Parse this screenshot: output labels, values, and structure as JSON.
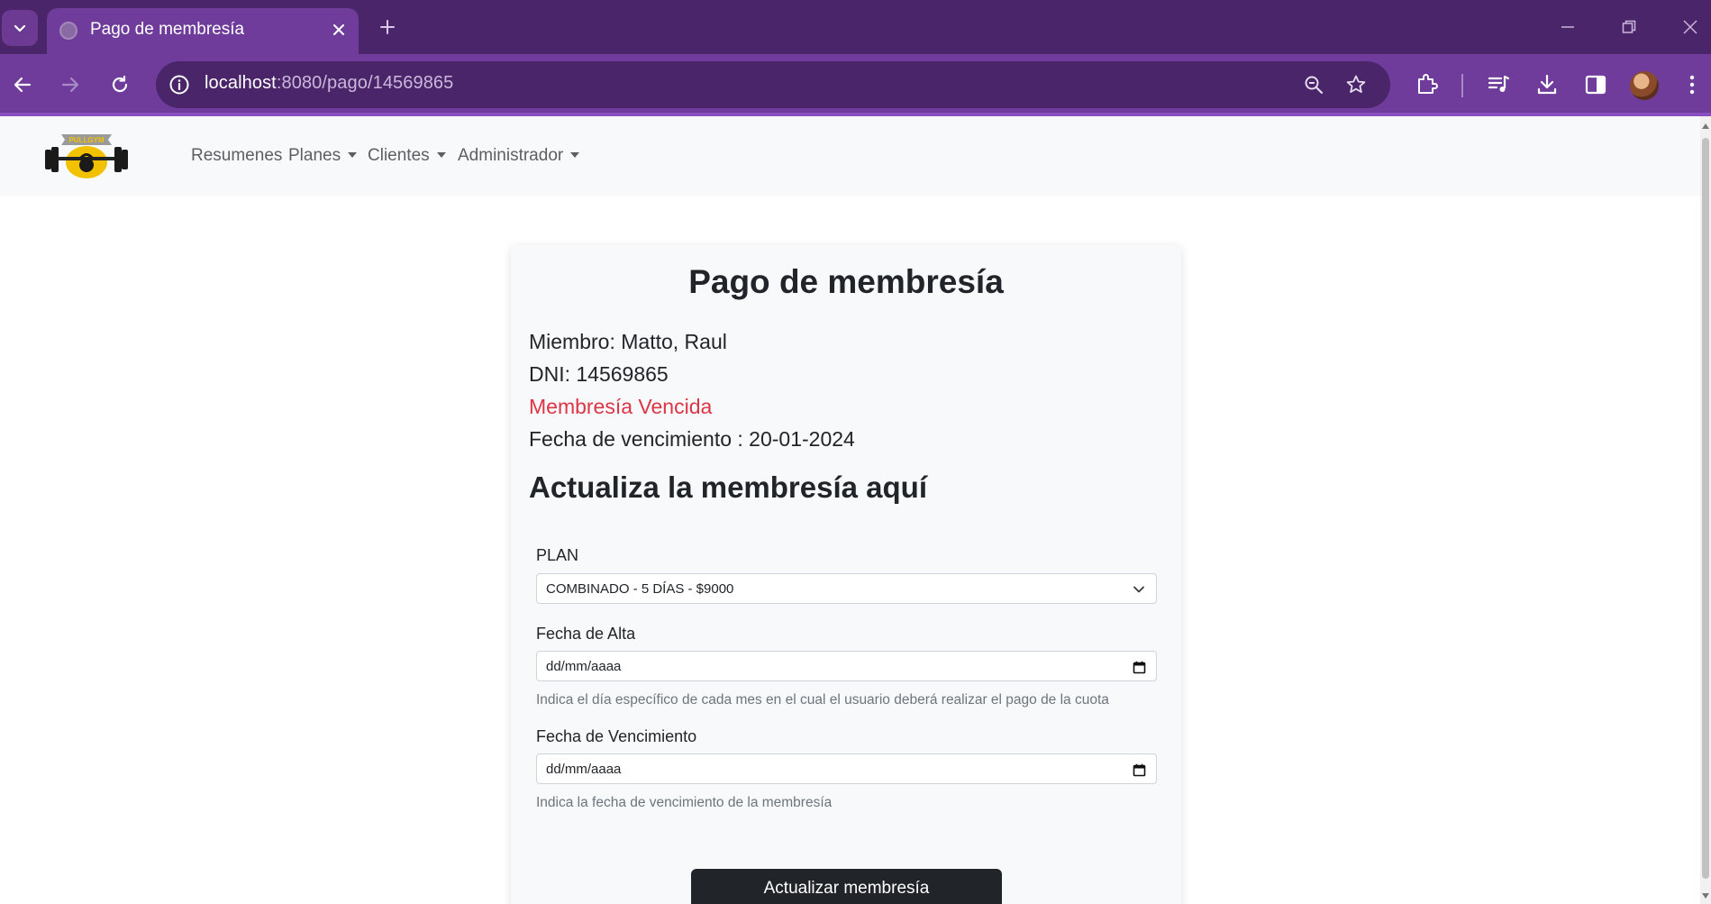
{
  "browser": {
    "tab_title": "Pago de membresía",
    "url_host": "localhost",
    "url_rest": ":8080/pago/14569865",
    "icons": [
      "tab-search-icon",
      "close-icon",
      "plus-icon",
      "minimize-icon",
      "restore-icon",
      "window-close-icon",
      "back-icon",
      "forward-icon",
      "reload-icon",
      "info-icon",
      "zoom-icon",
      "star-icon",
      "extensions-icon",
      "media-icon",
      "download-icon",
      "side-panel-icon",
      "menu-icon"
    ]
  },
  "navbar": {
    "logo_text": "PULLGYM",
    "links": {
      "resumenes": "Resumenes",
      "planes": "Planes",
      "clientes": "Clientes",
      "administrador": "Administrador"
    }
  },
  "card": {
    "title": "Pago de membresía",
    "miembro": "Miembro: Matto, Raul",
    "dni": "DNI: 14569865",
    "status": "Membresía Vencida",
    "status_color": "#dc3545",
    "vencimiento": "Fecha de vencimiento : 20-01-2024",
    "subtitle": "Actualiza la membresía aquí"
  },
  "form": {
    "plan_label": "PLAN",
    "plan_value": "COMBINADO - 5 DÍAS - $9000",
    "alta_label": "Fecha de Alta",
    "alta_placeholder": "dd/mm/aaaa",
    "alta_help": "Indica el día específico de cada mes en el cual el usuario deberá realizar el pago de la cuota",
    "venc_label": "Fecha de Vencimiento",
    "venc_placeholder": "dd/mm/aaaa",
    "venc_help": "Indica la fecha de vencimiento de la membresía",
    "submit_label": "Actualizar membresía"
  },
  "colors": {
    "tabstrip": "#4a2569",
    "toolbar": "#6f3c9b",
    "button_dark": "#212529"
  }
}
